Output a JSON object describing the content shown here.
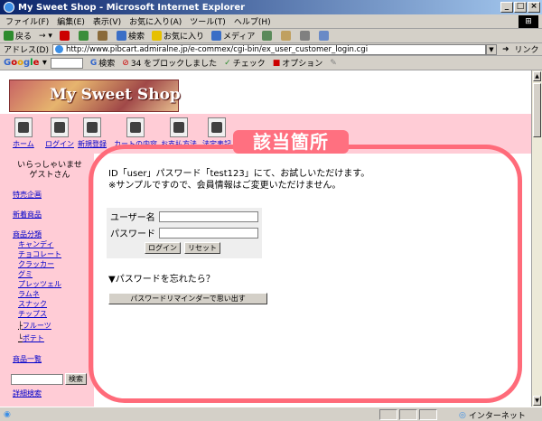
{
  "window": {
    "title": "My Sweet Shop - Microsoft Internet Explorer"
  },
  "menu": [
    "ファイル(F)",
    "編集(E)",
    "表示(V)",
    "お気に入り(A)",
    "ツール(T)",
    "ヘルプ(H)"
  ],
  "toolbar": {
    "back": "戻る",
    "search": "検索",
    "favorites": "お気に入り",
    "media": "メディア"
  },
  "address": {
    "label": "アドレス(D)",
    "url": "http://www.pibcart.admiralne.jp/e-commex/cgi-bin/ex_user_customer_login.cgi",
    "go": "リンク"
  },
  "googlebar": {
    "search_label": "検索",
    "blocked": "34 をブロックしました",
    "check": "チェック",
    "options": "オプション"
  },
  "shop": {
    "logo": "My Sweet Shop",
    "nav": [
      "ホーム",
      "ログイン",
      "新規登録",
      "カートの内容",
      "お支払方法",
      "法定表記"
    ],
    "welcome_line1": "いらっしゃいませ",
    "welcome_line2": "ゲストさん",
    "sidebar": {
      "special": "特売企画",
      "new": "新着商品",
      "category": "商品分類",
      "sub": [
        "キャンディ",
        "チョコレート",
        "クラッカー",
        "グミ",
        "プレッツェル",
        "ラムネ",
        "スナック",
        "チップス"
      ],
      "tree": [
        "フルーツ",
        "ポテト"
      ],
      "list": "商品一覧",
      "search_button": "検索",
      "advanced": "詳細検索"
    },
    "message_line1": "ID「user」パスワード「test123」にて、お試しいただけます。",
    "message_line2": "※サンプルですので、会員情報はご変更いただけません。",
    "form": {
      "user_label": "ユーザー名",
      "password_label": "パスワード",
      "login": "ログイン",
      "reset": "リセット"
    },
    "forgot": "▼パスワードを忘れたら？",
    "reminder": "パスワードリマインダーで思い出す"
  },
  "annotation": {
    "label": "該当箇所",
    "color": "#ff6b7a"
  },
  "status": {
    "zone": "インターネット"
  }
}
